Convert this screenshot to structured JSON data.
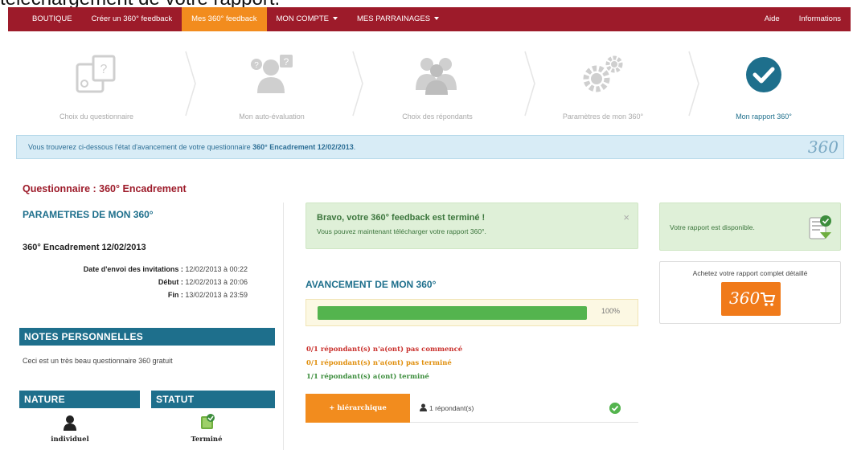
{
  "page_heading": "téléchargement de votre rapport.",
  "nav": {
    "items": [
      "BOUTIQUE",
      "Créer un 360° feedback",
      "Mes 360° feedback",
      "MON COMPTE",
      "MES PARRAINAGES"
    ],
    "right_items": [
      "Aide",
      "Informations"
    ],
    "active": "Mes 360° feedback"
  },
  "steps": [
    {
      "label": "Choix du questionnaire",
      "icon": "questionnaire-icon"
    },
    {
      "label": "Mon auto-évaluation",
      "icon": "self-evaluation-icon"
    },
    {
      "label": "Choix des répondants",
      "icon": "respondents-icon"
    },
    {
      "label": "Paramètres de mon 360°",
      "icon": "gears-icon"
    },
    {
      "label": "Mon rapport 360°",
      "icon": "check-circle-icon"
    }
  ],
  "info_bar": {
    "text": "Vous trouverez ci-dessous l'état d'avancement de votre questionnaire ",
    "bold": "360° Encadrement 12/02/2013",
    "suffix": ".",
    "logo": "360"
  },
  "questionnaire_title": "Questionnaire : 360° Encadrement",
  "params": {
    "title": "PARAMETRES DE MON 360°",
    "name": "360° Encadrement 12/02/2013",
    "rows": [
      {
        "label": "Date d'envoi des invitations :",
        "value": " 12/02/2013 à 00:22"
      },
      {
        "label": "Début :",
        "value": " 12/02/2013 à 20:06"
      },
      {
        "label": "Fin :",
        "value": " 13/02/2013 à 23:59"
      }
    ]
  },
  "notes": {
    "title": "NOTES PERSONNELLES",
    "text": "Ceci est un très beau questionnaire 360 gratuit"
  },
  "nature": {
    "title": "NATURE",
    "value": "individuel"
  },
  "statut": {
    "title": "STATUT",
    "value": "Terminé"
  },
  "alert": {
    "title": "Bravo, votre 360° feedback est terminé !",
    "text": "Vous pouvez maintenant télécharger votre rapport 360°.",
    "close": "×"
  },
  "avancement": {
    "title": "AVANCEMENT DE MON 360°",
    "progress": 1.0,
    "progress_label": "100%"
  },
  "responses": [
    {
      "text": "0/1 répondant(s) n'a(ont) pas commencé",
      "status": "red"
    },
    {
      "text": "0/1 répondant(s) n'a(ont) pas terminé",
      "status": "orange"
    },
    {
      "text": "1/1 répondant(s) a(ont) terminé",
      "status": "green"
    }
  ],
  "hierarchy": {
    "button_label": "+ hiérarchique",
    "count": "1 répondant(s)"
  },
  "report": {
    "available_text": "Votre rapport est disponible.",
    "buy_text": "Achetez votre rapport complet détaillé",
    "buy_logo": "360"
  },
  "colors": {
    "brand_red": "#9d1b2a",
    "accent_orange": "#f28c1e",
    "teal": "#1e6f8c",
    "success_green": "#54b44e"
  }
}
